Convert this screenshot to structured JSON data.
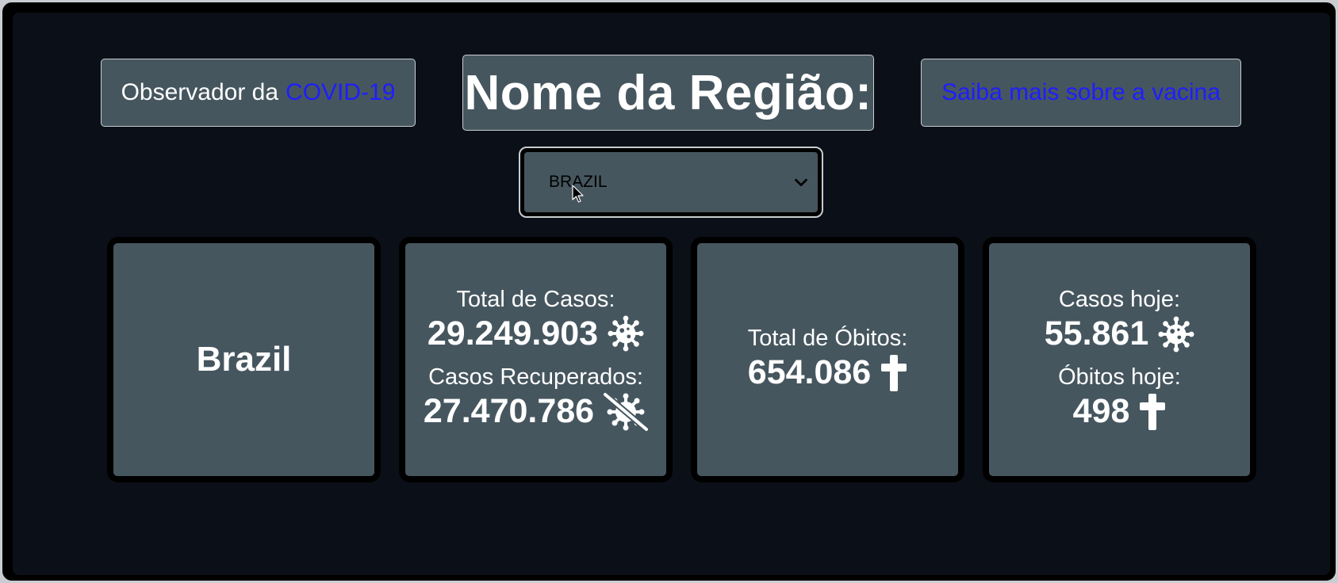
{
  "header": {
    "app_prefix": "Observador da",
    "app_link": "COVID-19",
    "title": "Nome da Região:",
    "vaccine_link": "Saiba mais sobre a vacina"
  },
  "region_select": {
    "selected": "BRAZIL"
  },
  "cards": {
    "region": {
      "name": "Brazil"
    },
    "totals": {
      "cases_label": "Total de Casos:",
      "cases_value": "29.249.903",
      "recovered_label": "Casos Recuperados:",
      "recovered_value": "27.470.786"
    },
    "deaths": {
      "label": "Total de Óbitos:",
      "value": "654.086"
    },
    "today": {
      "cases_label": "Casos hoje:",
      "cases_value": "55.861",
      "deaths_label": "Óbitos hoje:",
      "deaths_value": "498"
    }
  },
  "icons": {
    "virus": "virus-icon",
    "virus_slash": "virus-slash-icon",
    "cross": "cross-icon",
    "chevron": "chevron-down-icon"
  },
  "colors": {
    "background": "#0b0f17",
    "panel": "#46565f",
    "link": "#1e1eff",
    "text": "#ffffff"
  }
}
